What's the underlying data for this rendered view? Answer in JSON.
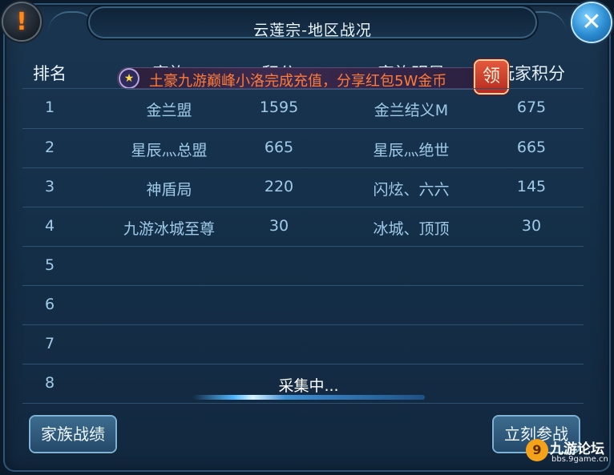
{
  "title": "云莲宗-地区战况",
  "table": {
    "headers": [
      "排名",
      "家族",
      "积分",
      "家族明星",
      "玩家积分"
    ],
    "rows": [
      {
        "rank": "1",
        "family": "金兰盟",
        "score": "1595",
        "star": "金兰结义M",
        "player_score": "675"
      },
      {
        "rank": "2",
        "family": "星辰灬总盟",
        "score": "665",
        "star": "星辰灬绝世",
        "player_score": "665"
      },
      {
        "rank": "3",
        "family": "神盾局",
        "score": "220",
        "star": "闪炫、六六",
        "player_score": "145"
      },
      {
        "rank": "4",
        "family": "九游冰城至尊",
        "score": "30",
        "star": "冰城、顶顶",
        "player_score": "30"
      },
      {
        "rank": "5",
        "family": "",
        "score": "",
        "star": "",
        "player_score": ""
      },
      {
        "rank": "6",
        "family": "",
        "score": "",
        "star": "",
        "player_score": ""
      },
      {
        "rank": "7",
        "family": "",
        "score": "",
        "star": "",
        "player_score": ""
      },
      {
        "rank": "8",
        "family": "",
        "score": "",
        "star": "",
        "player_score": ""
      }
    ]
  },
  "ticker": {
    "text": "土豪九游巅峰小洛完成充值，分享红包5W金币",
    "claim_label": "领"
  },
  "collecting": {
    "label": "采集中..."
  },
  "buttons": {
    "family_record": "家族战绩",
    "join_battle": "立刻参战"
  },
  "watermark": {
    "title": "九游论坛",
    "url": "bbs.9game.cn",
    "logo_glyph": "9"
  },
  "icons": {
    "alert": "!",
    "close": "✕",
    "star": "★"
  },
  "colors": {
    "ticker_text": "#ff7b3a",
    "claim_button": "#c8372a",
    "panel_bg": "#15304a"
  }
}
